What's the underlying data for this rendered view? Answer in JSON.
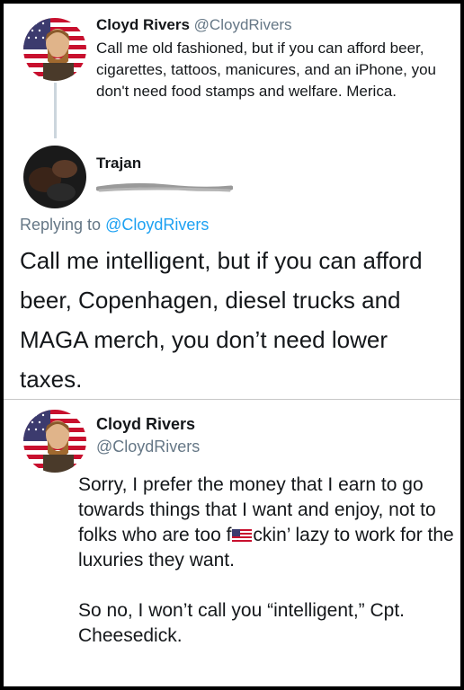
{
  "tweet1": {
    "name": "Cloyd Rivers",
    "handle": "@CloydRivers",
    "text": "Call me old fashioned, but if you can afford beer, cigarettes, tattoos, manicures, and an iPhone, you don't need food stamps and welfare. Merica."
  },
  "tweet2": {
    "name": "Trajan",
    "replying_prefix": "Replying to",
    "replying_handle": "@CloydRivers",
    "text": "Call me intelligent, but if you can afford beer, Copenhagen, diesel trucks and MAGA  merch, you don’t need lower taxes."
  },
  "tweet3": {
    "name": "Cloyd Rivers",
    "handle": "@CloydRivers",
    "text_part1": "Sorry, I prefer the money that I earn to go towards things that I want and enjoy, not to folks who are too f",
    "emoji": "us-flag-icon",
    "text_part2": "ckin’ lazy to work for the luxuries they want.",
    "text_para2": "So no, I won’t call you “intelligent,” Cpt. Cheesedick."
  },
  "colors": {
    "link": "#1da1f2",
    "muted": "#657786",
    "text": "#14171a"
  }
}
